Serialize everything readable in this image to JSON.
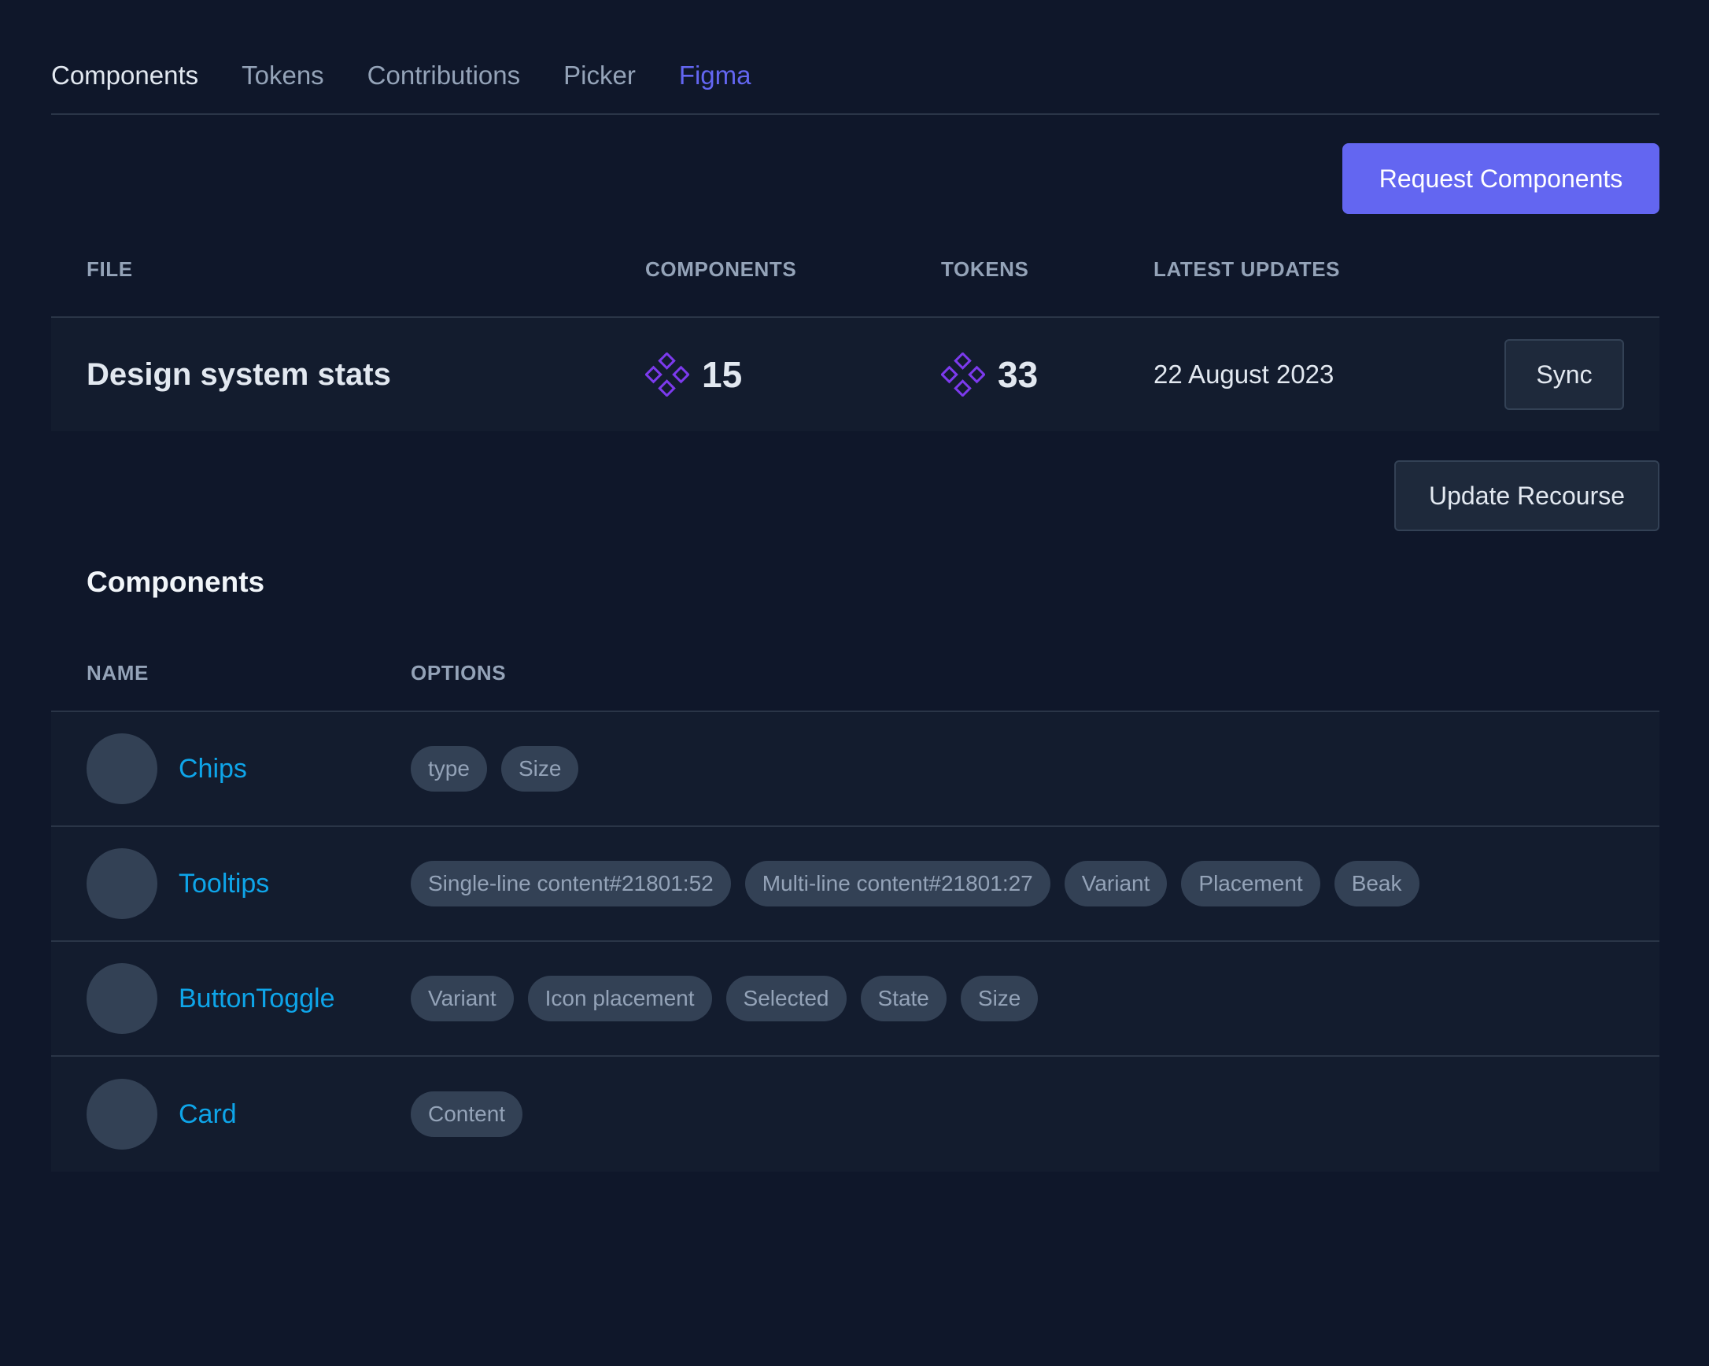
{
  "tabs": [
    {
      "label": "Components"
    },
    {
      "label": "Tokens"
    },
    {
      "label": "Contributions"
    },
    {
      "label": "Picker"
    },
    {
      "label": "Figma"
    }
  ],
  "colors": {
    "accent": "#6366f1",
    "link": "#0ea5e9",
    "background": "#0f172a",
    "icon": "#7c3aed"
  },
  "actions": {
    "request_label": "Request Components",
    "sync_label": "Sync",
    "update_label": "Update Recourse"
  },
  "stats_table": {
    "headers": {
      "file": "FILE",
      "components": "COMPONENTS",
      "tokens": "TOKENS",
      "updates": "LATEST UPDATES"
    },
    "row": {
      "file": "Design system stats",
      "components_icon": "component-icon",
      "components": "15",
      "tokens_icon": "component-icon",
      "tokens": "33",
      "updated": "22 August 2023"
    }
  },
  "components_section": {
    "title": "Components",
    "headers": {
      "name": "NAME",
      "options": "OPTIONS"
    },
    "rows": [
      {
        "name": "Chips",
        "options": [
          "type",
          "Size"
        ]
      },
      {
        "name": "Tooltips",
        "options": [
          "Single-line content#21801:52",
          "Multi-line content#21801:27",
          "Variant",
          "Placement",
          "Beak"
        ]
      },
      {
        "name": "ButtonToggle",
        "options": [
          "Variant",
          "Icon placement",
          "Selected",
          "State",
          "Size"
        ]
      },
      {
        "name": "Card",
        "options": [
          "Content"
        ]
      }
    ]
  }
}
